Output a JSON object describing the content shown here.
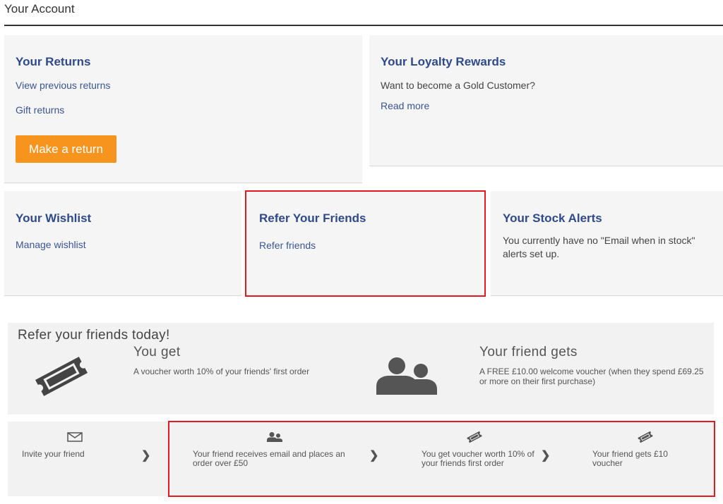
{
  "page": {
    "title": "Your Account"
  },
  "returns": {
    "title": "Your Returns",
    "links": [
      "View previous returns",
      "Gift returns"
    ],
    "button_label": "Make a return"
  },
  "loyalty": {
    "title": "Your Loyalty Rewards",
    "text": "Want to become a Gold Customer?",
    "link": "Read more"
  },
  "wishlist": {
    "title": "Your Wishlist",
    "link": "Manage wishlist"
  },
  "refer": {
    "title": "Refer Your Friends",
    "link": "Refer friends"
  },
  "stock_alerts": {
    "title": "Your Stock Alerts",
    "text": "You currently have no \"Email when in stock\" alerts set up."
  },
  "promo": {
    "heading": "Refer your friends today!",
    "you_get": {
      "title": "You get",
      "text": "A voucher worth 10% of your friends' first order",
      "icon": "voucher-icon"
    },
    "friend_gets": {
      "title": "Your friend gets",
      "text": "A FREE £10.00 welcome voucher (when they spend £69.25 or more on their first purchase)",
      "icon": "users-icon"
    }
  },
  "steps": [
    {
      "text": "Invite your friend",
      "icon": "envelope-icon"
    },
    {
      "text": "Your friend receives email and places an order over £50",
      "icon": "users-icon"
    },
    {
      "text": "You get voucher worth 10% of your friends first order",
      "icon": "voucher-icon"
    },
    {
      "text": "Your friend gets £10 voucher",
      "icon": "voucher-icon"
    }
  ],
  "colors": {
    "link": "#3a5592",
    "title": "#2f4a8a",
    "button": "#f7941d",
    "highlight": "#e21b23",
    "card_bg": "#f5f5f5"
  }
}
